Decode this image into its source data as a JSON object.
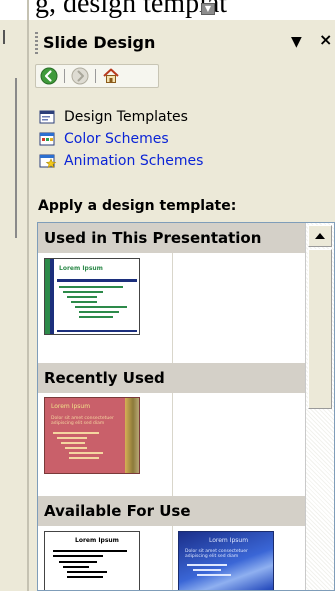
{
  "top_strip": {
    "clipped_text": "g, design templat"
  },
  "pane": {
    "title": "Slide Design",
    "icons": {
      "back": "back-arrow-icon",
      "forward": "forward-arrow-icon",
      "home": "home-icon",
      "dropdown": "dropdown-triangle-icon",
      "close": "close-icon"
    }
  },
  "links": [
    {
      "label": "Design Templates",
      "icon": "design-templates-icon",
      "active": true
    },
    {
      "label": "Color Schemes",
      "icon": "color-schemes-icon",
      "active": false
    },
    {
      "label": "Animation Schemes",
      "icon": "animation-schemes-icon",
      "active": false
    }
  ],
  "section_heading": "Apply a design template:",
  "gallery": {
    "groups": [
      {
        "name": "Used in This Presentation"
      },
      {
        "name": "Recently Used"
      },
      {
        "name": "Available For Use"
      }
    ],
    "thumb_texts": {
      "lorem_title": "Lorem Ipsum",
      "lorem_body": "Dolor sit amet consectetuer adipiscing elit sed diam"
    }
  },
  "colors": {
    "pane_bg": "#ece9d8",
    "link_blue": "#0b24d6",
    "group_header_bg": "#d4d0c8",
    "nav_back_green": "#3f9a3a",
    "thumb_green": "#2d8a4a",
    "thumb_navy": "#1c2f7c",
    "thumb_rose": "#c9606a",
    "thumb_blue": "#2a4fbf"
  }
}
